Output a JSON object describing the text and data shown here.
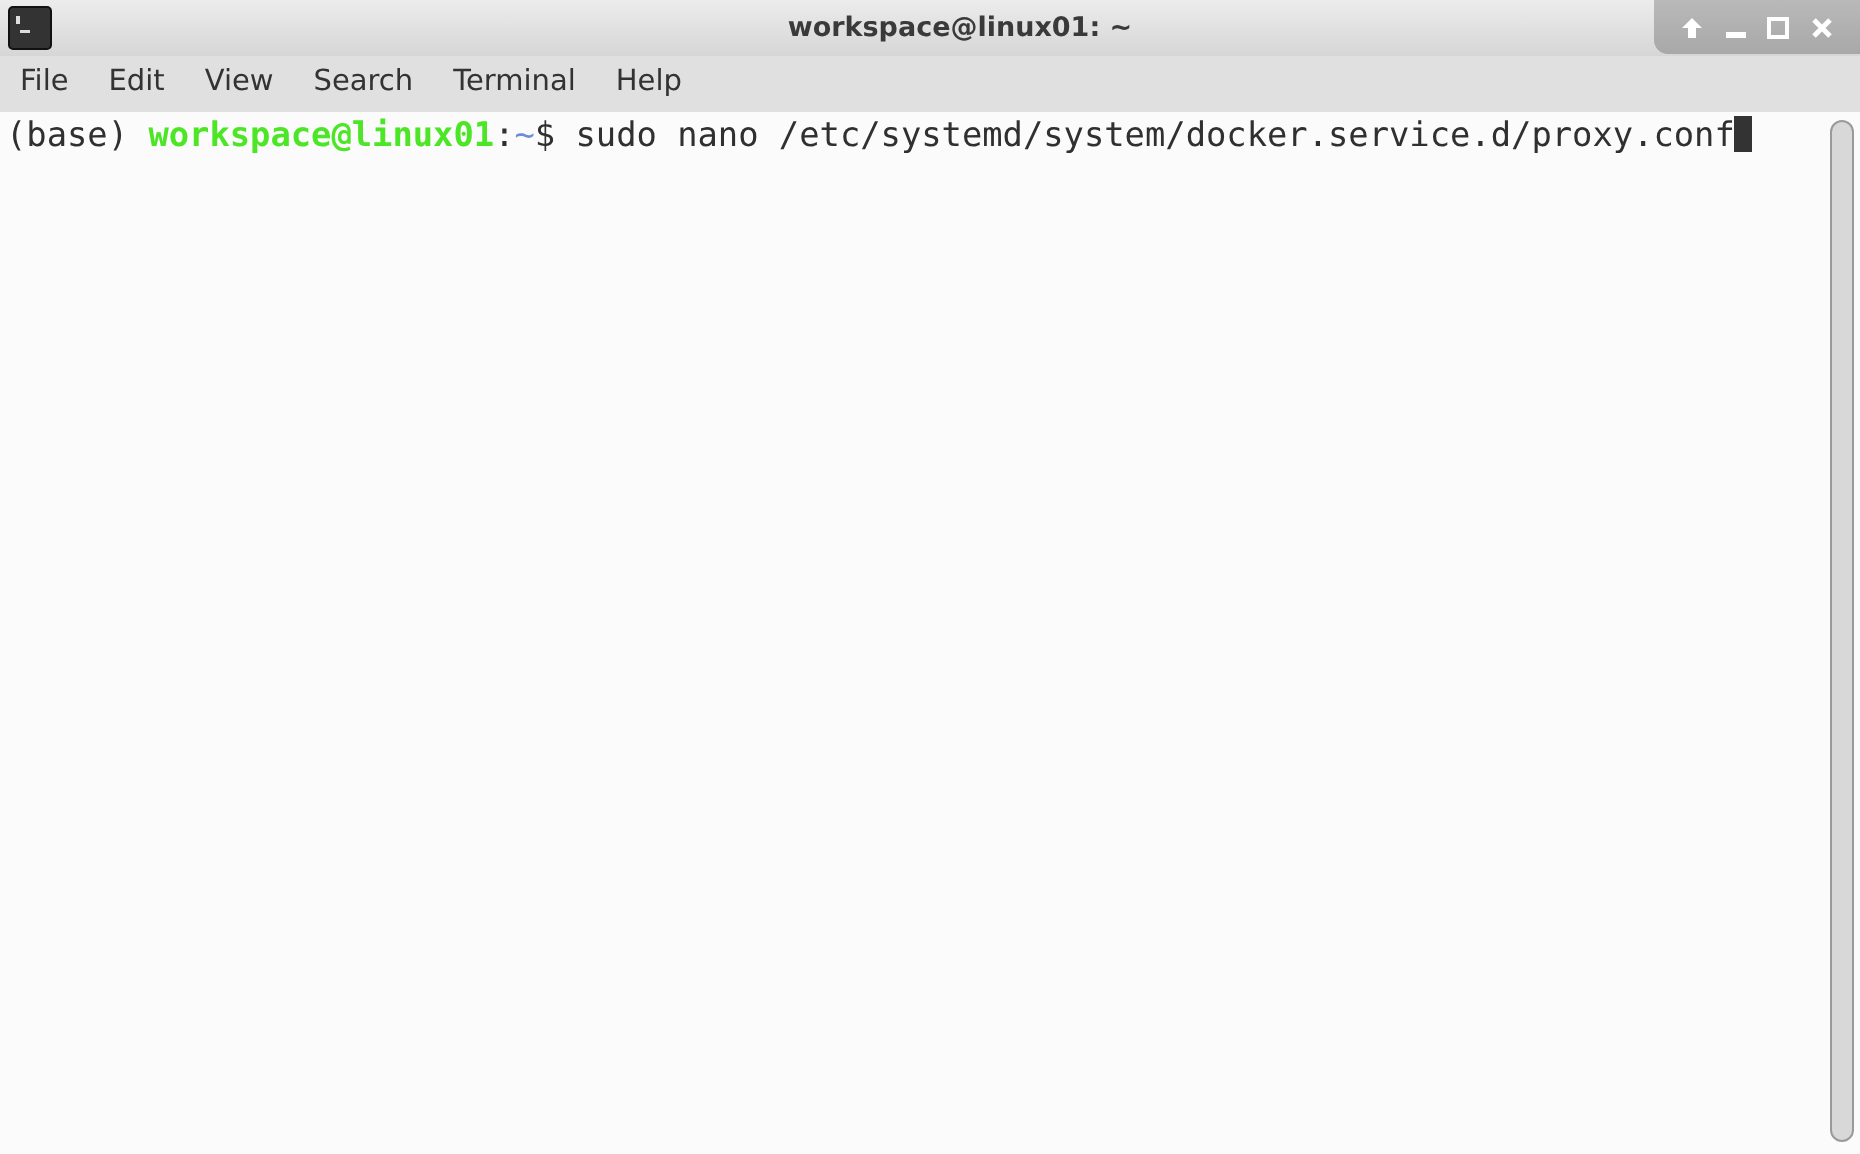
{
  "window": {
    "title": "workspace@linux01: ~"
  },
  "menu": [
    "File",
    "Edit",
    "View",
    "Search",
    "Terminal",
    "Help"
  ],
  "terminal": {
    "lines": [
      {
        "segments": [
          {
            "text": "(base) ",
            "color": "#303030",
            "bold": false
          },
          {
            "text": "workspace@linux01",
            "color": "#4ce626",
            "bold": true
          },
          {
            "text": ":",
            "color": "#303030",
            "bold": false
          },
          {
            "text": "~",
            "color": "#6b8fd6",
            "bold": false
          },
          {
            "text": "$ sudo nano /etc/systemd/system/docker.service.d/proxy.conf",
            "color": "#303030",
            "bold": false
          }
        ],
        "cursor": true
      }
    ]
  }
}
